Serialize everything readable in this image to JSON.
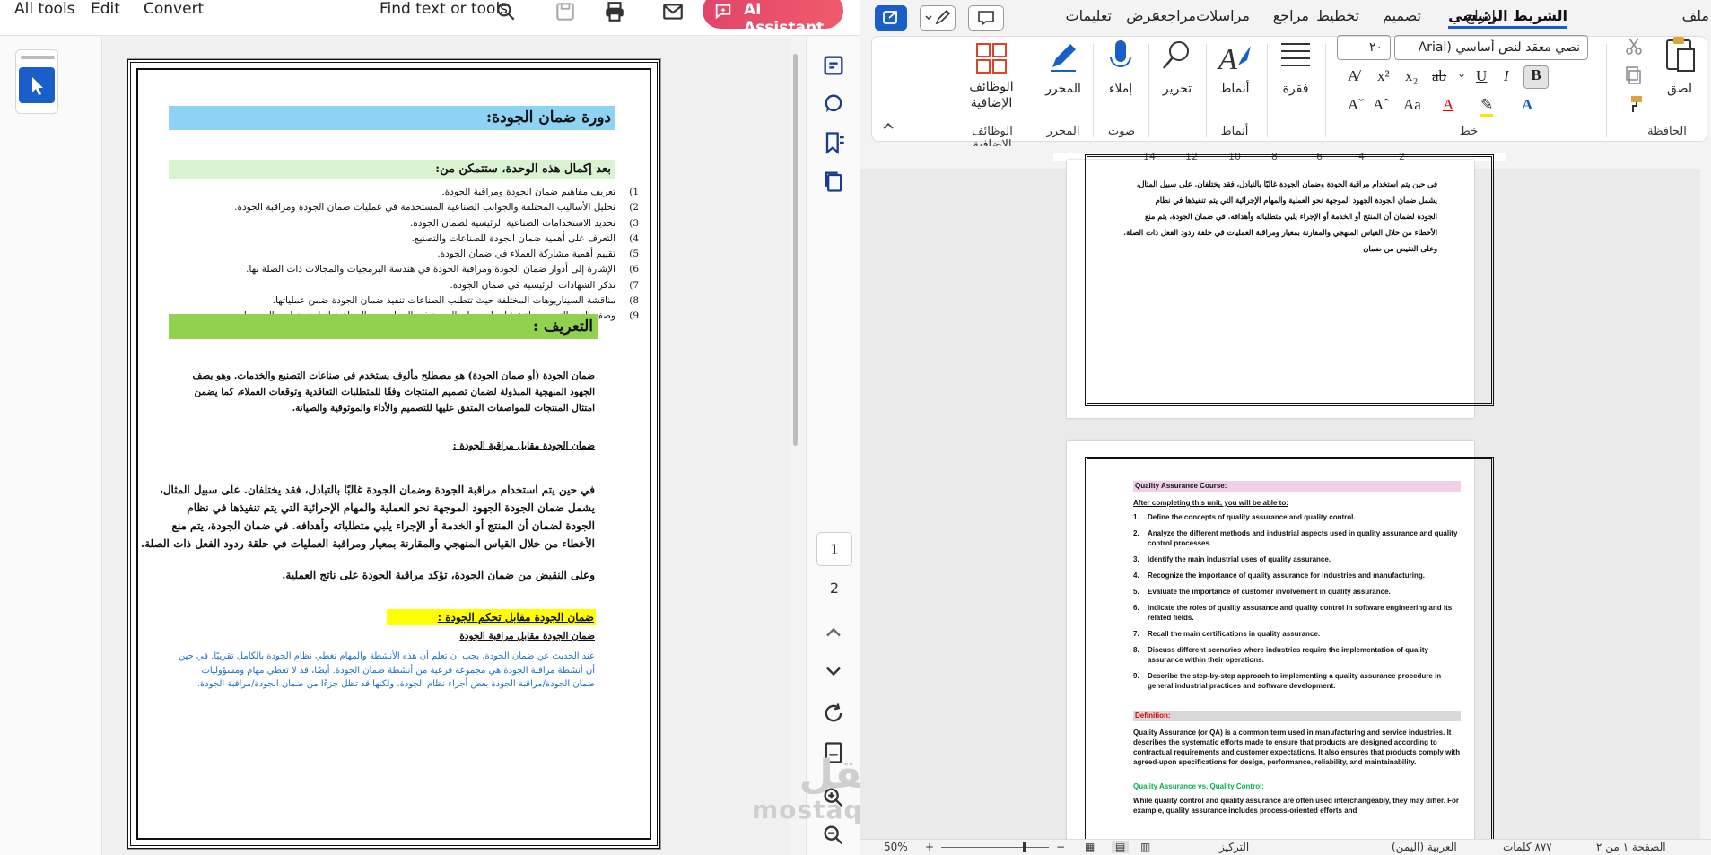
{
  "pdf": {
    "menu": [
      "All tools",
      "Edit",
      "Convert"
    ],
    "find_label": "Find text or tools",
    "ai_label": "AI Assistant",
    "pages": [
      "1",
      "2"
    ],
    "doc": {
      "title": "دورة ضمان الجودة:",
      "intro": "بعد إكمال هذه الوحدة، ستتمكن من:",
      "objectives": [
        {
          "n": "1)",
          "t": "تعريف مفاهيم ضمان الجودة ومراقبة الجودة."
        },
        {
          "n": "2)",
          "t": "تحليل الأساليب المختلفة والجوانب الصناعية المستخدمة في عمليات ضمان الجودة ومراقبة الجودة."
        },
        {
          "n": "3)",
          "t": "تحديد الاستخدامات الصناعية الرئيسية لضمان الجودة."
        },
        {
          "n": "4)",
          "t": "التعرف على أهمية ضمان الجودة للصناعات والتصنيع."
        },
        {
          "n": "5)",
          "t": "تقييم أهمية مشاركة العملاء في ضمان الجودة."
        },
        {
          "n": "6)",
          "t": "الإشارة إلى أدوار ضمان الجودة ومراقبة الجودة في هندسة البرمجيات والمجالات ذات الصلة بها."
        },
        {
          "n": "7)",
          "t": "تذكر الشهادات الرئيسية في ضمان الجودة."
        },
        {
          "n": "8)",
          "t": "مناقشة السيناريوهات المختلفة حيث تتطلب الصناعات تنفيذ ضمان الجودة ضمن عملياتها."
        },
        {
          "n": "9)",
          "t": "وصف النهج التدريجي لتنفيذ إجراء ضمان الجودة في الممارسات الصناعية العامة وتطوير البرمجيات."
        }
      ],
      "definition_heading": "التعريف :",
      "definition_text": "ضمان الجودة (أو ضمان الجودة) هو مصطلح مألوف يستخدم في صناعات التصنيع والخدمات. وهو يصف الجهود المنهجية المبذولة لضمان تصميم المنتجات وفقًا للمتطلبات التعاقدية وتوقعات العملاء، كما يضمن امتثال المنتجات للمواصفات المتفق عليها للتصميم والأداء والموثوقية والصيانة.",
      "subheading1": "ضمان الجودة مقابل مراقبة الجودة :",
      "bold_para_lines": [
        "في حين يتم استخدام مراقبة الجودة وضمان الجودة غالبًا بالتبادل، فقد يختلفان. على سبيل المثال،",
        "يشمل ضمان الجودة الجهود الموجهة نحو العملية والمهام الإجرائية التي يتم تنفيذها في نظام",
        "الجودة لضمان أن المنتج أو الخدمة أو الإجراء يلبي متطلباته وأهدافه. في ضمان الجودة، يتم منع",
        "الأخطاء من خلال القياس المنهجي والمقارنة بمعيار ومراقبة العمليات في حلقة ردود الفعل ذات الصلة."
      ],
      "bold_para_last": "وعلى النقيض من ضمان الجودة، تؤكد مراقبة الجودة على ناتج العملية.",
      "highlight_heading": "ضمان الجودة مقابل تحكم الجودة :",
      "subheading2": "ضمان الجودة مقابل مراقبة الجودة",
      "blue_lines": [
        "عند الحديث عن ضمان الجودة، يجب أن تعلم أن هذه الأنشطة والمهام تغطي نظام الجودة بالكامل تقريبًا. في حين",
        "أن أنشطة مراقبة الجودة هي مجموعة فرعية من أنشطة ضمان الجودة. أيضًا، قد لا تغطي مهام ومسؤوليات",
        "ضمان الجودة/مراقبة الجودة بعض أجزاء نظام الجودة، ولكنها قد تظل جزءًا من ضمان الجودة/مراقبة الجودة."
      ]
    },
    "watermark": "mostaql.com",
    "watermark_ar": "مستقل"
  },
  "word": {
    "tabs": [
      "ملف",
      "الشريط الرئيسي",
      "إدراج",
      "تصميم",
      "تخطيط",
      "مراجع",
      "مراسلات",
      "مراجعة",
      "عرض",
      "تعليمات"
    ],
    "active_tab": "الشريط الرئيسي",
    "ribbon": {
      "clipboard": {
        "label": "الحافظة",
        "paste": "لصق"
      },
      "font": {
        "label": "خط",
        "font_name": "نصي معقد لنص أساسي (Arial",
        "font_size": "٢٠"
      },
      "paragraph": "فقرة",
      "styles": {
        "label": "أنماط",
        "btn": "أنماط"
      },
      "editing": "تحرير",
      "voice": {
        "label": "صوت",
        "btn": "إملاء"
      },
      "editor": {
        "label": "المحرر",
        "btn": "المحرر"
      },
      "addins": {
        "label": "الوظائف الإضافية",
        "btn": "الوظائف الإضافية"
      }
    },
    "ruler": [
      "2",
      "4",
      "6",
      "8",
      "10",
      "12",
      "14"
    ],
    "page1_lines": [
      "في حين يتم استخدام مراقبة الجودة وضمان الجودة غالبًا بالتبادل، فقد يختلفان. على سبيل المثال،",
      "يشمل ضمان الجودة الجهود الموجهة نحو العملية والمهام الإجرائية التي يتم تنفيذها في نظام",
      "الجودة لضمان أن المنتج أو الخدمة أو الإجراء يلبي متطلباته وأهدافه. في ضمان الجودة، يتم منع",
      "الأخطاء من خلال القياس المنهجي والمقارنة بمعيار ومراقبة العمليات في حلقة ردود الفعل ذات الصلة."
    ],
    "page1_last": "وعلى النقيض من ضمان",
    "page2": {
      "title": "Quality Assurance Course:",
      "intro": "After completing this unit, you will be able to:",
      "items": [
        {
          "n": "1.",
          "t": "Define the concepts of quality assurance and quality control."
        },
        {
          "n": "2.",
          "t": "Analyze the different methods and industrial aspects used in quality assurance and quality control processes."
        },
        {
          "n": "3.",
          "t": "Identify the main industrial uses of quality assurance."
        },
        {
          "n": "4.",
          "t": "Recognize the importance of quality assurance for industries and manufacturing."
        },
        {
          "n": "5.",
          "t": "Evaluate the importance of customer involvement in quality assurance."
        },
        {
          "n": "6.",
          "t": "Indicate the roles of quality assurance and quality control in software engineering and its related fields."
        },
        {
          "n": "7.",
          "t": "Recall the main certifications in quality assurance."
        },
        {
          "n": "8.",
          "t": "Discuss different scenarios where industries require the implementation of quality assurance within their operations."
        },
        {
          "n": "9.",
          "t": "Describe the step-by-step approach to implementing a quality assurance procedure in general industrial practices and software development."
        }
      ],
      "definition": "Definition:",
      "def_text": "Quality Assurance (or QA) is a common term used in manufacturing and service industries. It describes the systematic efforts made to ensure that products are designed according to contractual requirements and customer expectations. It also ensures that products comply with agreed-upon specifications for design, performance, reliability, and maintainability.",
      "vs_heading": "Quality Assurance vs. Quality Control:",
      "vs_text": "While quality control and quality assurance are often used interchangeably, they may differ. For example, quality assurance includes process-oriented efforts and"
    },
    "status": {
      "page": "الصفحة ١ من ٢",
      "words": "٨٧٧ كلمات",
      "lang": "العربية (اليمن)",
      "focus": "التركيز",
      "zoom": "50%"
    }
  },
  "colors": {
    "accent": "#1a5ec9",
    "ai_button": "#e2446a",
    "title_bar": "#8fd3f4",
    "intro_bar": "#d9f2d0",
    "def_bar": "#92d050",
    "highlight": "#ffff00",
    "blue_text": "#1f6fc5",
    "en_title_bar": "#f2cfe8",
    "en_def": "#e00000",
    "en_vs": "#00b050"
  }
}
